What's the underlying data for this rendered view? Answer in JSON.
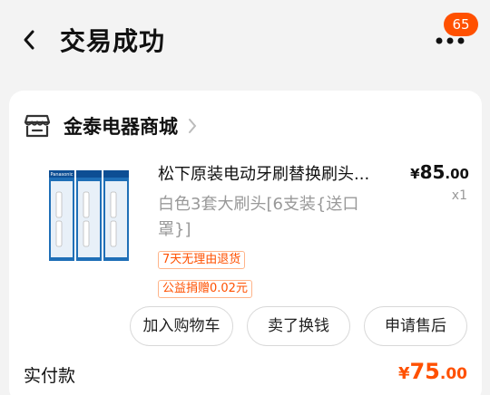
{
  "header": {
    "title": "交易成功",
    "notification_count": "65",
    "back_icon": "chevron-left-icon",
    "more_icon": "more-dots-icon"
  },
  "order": {
    "shop_name": "金泰电器商城",
    "shop_icon": "store-icon",
    "product": {
      "title": "松下原装电动牙刷替换刷头...",
      "sku": "白色3套大刷头[6支装{送口罩}]",
      "price_currency": "¥",
      "price_int": "85",
      "price_dec": ".00",
      "quantity": "x1",
      "image_brand": "Panasonic"
    },
    "tags": [
      "7天无理由退货",
      "公益捐赠0.02元"
    ],
    "actions": [
      "加入购物车",
      "卖了换钱",
      "申请售后"
    ],
    "payment": {
      "label": "实付款",
      "currency": "¥",
      "int": "75",
      "dec": ".00"
    }
  },
  "colors": {
    "accent": "#ff5000",
    "background": "#f3f3f3",
    "card": "#ffffff"
  }
}
